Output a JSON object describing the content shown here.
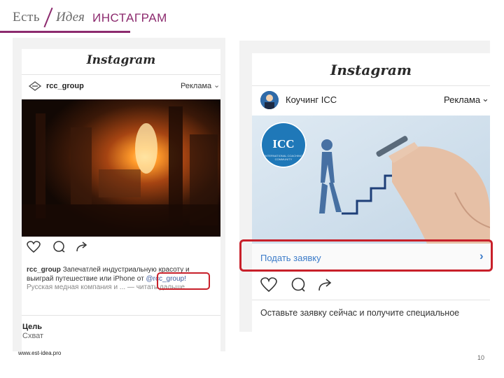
{
  "header": {
    "logo_est": "Есть",
    "logo_idea": "Идея",
    "title": "ИНСТАГРАМ",
    "accent_color": "#8c2a6e"
  },
  "left_post": {
    "app_name": "Instagram",
    "account": "rcc_group",
    "ad_label": "Реклама",
    "caption_account": "rcc_group",
    "caption_line1": "Запечатлей индустриальную красоту и",
    "caption_line2a": "выиграй путешествие или iPhone от",
    "caption_mention": "@rcc_group!",
    "caption_line3": "Русская медная компания и ... — читать дальше",
    "cta_label": "Цель",
    "cta_sub": "Схват"
  },
  "right_post": {
    "app_name": "Instagram",
    "account": "Коучинг ICC",
    "ad_label": "Реклама",
    "badge_text": "ICC",
    "badge_ring": "INTERNATIONAL COACHING COMMUNITY",
    "cta_text": "Подать заявку",
    "caption": "Оставьте заявку сейчас и получите специальное"
  },
  "footer": {
    "site": "www.est-idea.pro",
    "page_number": "10"
  },
  "icons": [
    "heart-icon",
    "comment-icon",
    "share-icon",
    "chevron-right-icon",
    "chevron-down-icon"
  ],
  "highlight_color": "#c8202a",
  "link_color": "#3d7cc9"
}
